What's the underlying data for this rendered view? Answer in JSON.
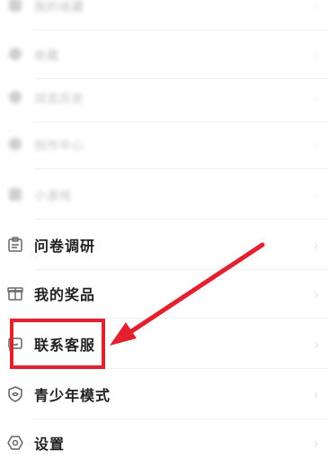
{
  "menu": {
    "items": [
      {
        "label": "我的收藏",
        "icon": "generic-icon",
        "blurred": true
      },
      {
        "label": "收藏",
        "icon": "star-icon",
        "blurred": true
      },
      {
        "label": "浏览历史",
        "icon": "history-icon",
        "blurred": true
      },
      {
        "label": "创作中心",
        "icon": "lightbulb-icon",
        "blurred": true
      },
      {
        "label": "小游戏",
        "icon": "gamepad-icon",
        "blurred": true
      },
      {
        "label": "问卷调研",
        "icon": "survey-icon",
        "blurred": false
      },
      {
        "label": "我的奖品",
        "icon": "gift-icon",
        "blurred": false
      },
      {
        "label": "联系客服",
        "icon": "chat-icon",
        "blurred": false
      },
      {
        "label": "青少年模式",
        "icon": "shield-icon",
        "blurred": false
      },
      {
        "label": "设置",
        "icon": "gear-icon",
        "blurred": false
      }
    ]
  },
  "annotation": {
    "highlight_color": "#e3202d",
    "arrow_color": "#e3202d"
  }
}
